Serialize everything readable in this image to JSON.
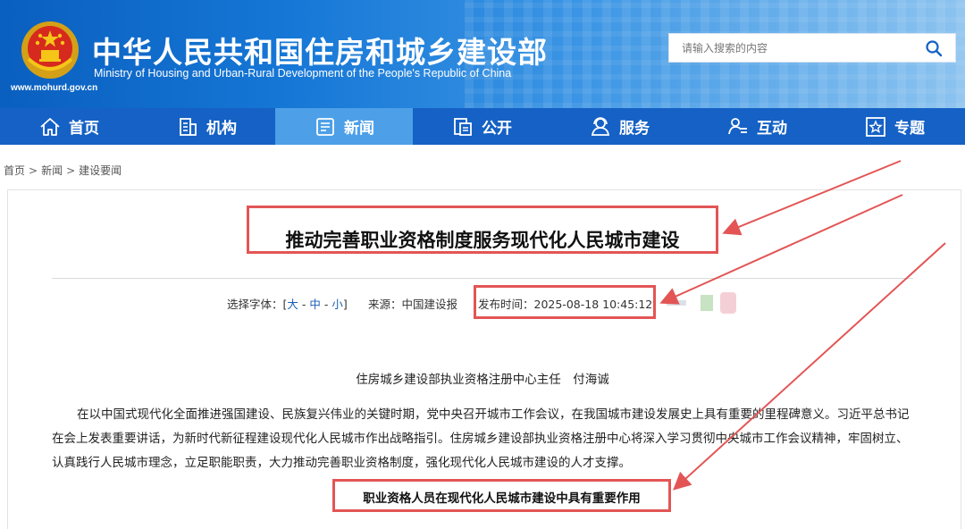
{
  "header": {
    "site_title": "中华人民共和国住房和城乡建设部",
    "site_subtitle": "Ministry of Housing and Urban-Rural Development of the People's Republic of China",
    "site_url": "www.mohurd.gov.cn",
    "search_placeholder": "请输入搜索的内容"
  },
  "nav": {
    "items": [
      {
        "label": "首页",
        "icon": "home-icon"
      },
      {
        "label": "机构",
        "icon": "building-icon"
      },
      {
        "label": "新闻",
        "icon": "news-icon"
      },
      {
        "label": "公开",
        "icon": "document-icon"
      },
      {
        "label": "服务",
        "icon": "service-icon"
      },
      {
        "label": "互动",
        "icon": "interaction-icon"
      },
      {
        "label": "专题",
        "icon": "star-icon"
      }
    ],
    "active": "新闻"
  },
  "breadcrumb": [
    "首页",
    "新闻",
    "建设要闻"
  ],
  "article": {
    "title": "推动完善职业资格制度服务现代化人民城市建设",
    "font_label": "选择字体：[",
    "font_large": "大",
    "font_medium": "中",
    "font_small": "小",
    "font_close": "]",
    "source": "来源：中国建设报",
    "pub_time": "发布时间：2025-08-18 10:45:12",
    "author": "住房城乡建设部执业资格注册中心主任　付海诚",
    "paragraph": "在以中国式现代化全面推进强国建设、民族复兴伟业的关键时期，党中央召开城市工作会议，在我国城市建设发展史上具有重要的里程碑意义。习近平总书记在会上发表重要讲话，为新时代新征程建设现代化人民城市作出战略指引。住房城乡建设部执业资格注册中心将深入学习贯彻中央城市工作会议精神，牢固树立、认真践行人民城市理念，立足职能职责，大力推动完善职业资格制度，强化现代化人民城市建设的人才支撑。",
    "subheading": "职业资格人员在现代化人民城市建设中具有重要作用"
  },
  "colors": {
    "nav_bg": "#1561c5",
    "nav_active": "#4da0e8",
    "highlight": "#e35555",
    "link": "#1a5fb4"
  }
}
